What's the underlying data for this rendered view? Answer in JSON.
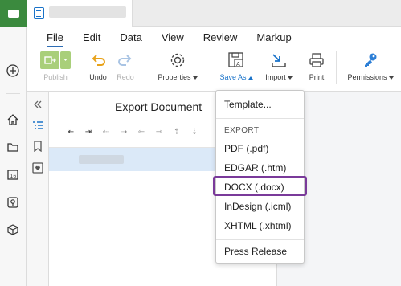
{
  "window": {
    "document_title": ""
  },
  "menu": [
    "File",
    "Edit",
    "Data",
    "View",
    "Review",
    "Markup"
  ],
  "active_menu": "File",
  "toolbar": {
    "publish": "Publish",
    "undo": "Undo",
    "redo": "Redo",
    "properties": "Properties",
    "save_as": "Save As",
    "import": "Import",
    "print": "Print",
    "permissions": "Permissions"
  },
  "panel": {
    "title": "Export Document"
  },
  "dropdown": {
    "template": "Template...",
    "section_header": "EXPORT",
    "items": [
      "PDF (.pdf)",
      "EDGAR (.htm)",
      "DOCX (.docx)",
      "InDesign (.icml)",
      "XHTML (.xhtml)"
    ],
    "press_release": "Press Release",
    "highlighted": "DOCX (.docx)"
  },
  "colors": {
    "brand_green": "#3b8a3e",
    "accent_blue": "#1a73c9",
    "highlight_purple": "#7a3a9a",
    "selection": "#dbe9f8"
  }
}
